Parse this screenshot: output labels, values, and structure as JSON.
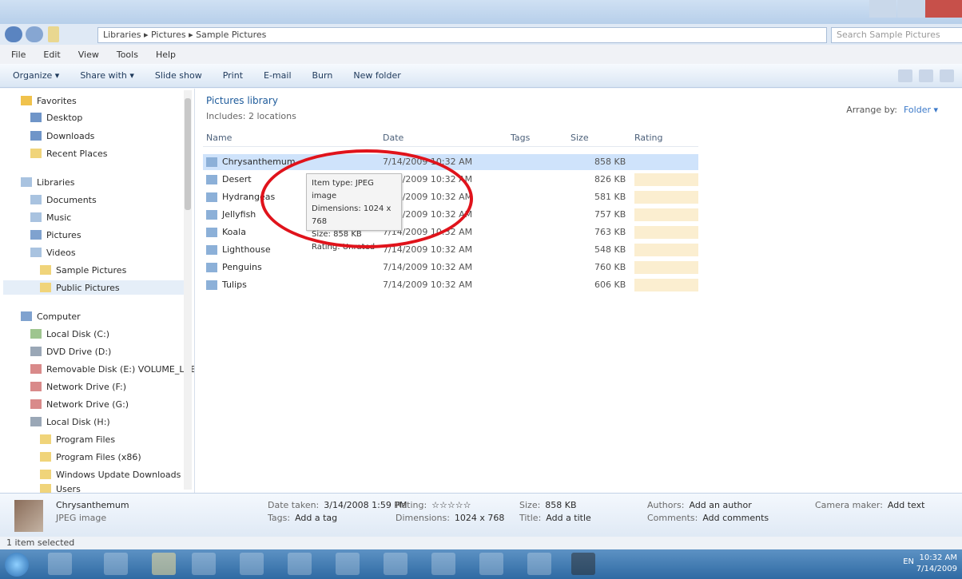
{
  "window": {
    "address": "Libraries ▸ Pictures ▸ Sample Pictures",
    "search_placeholder": "Search Sample Pictures"
  },
  "menu": [
    "File",
    "Edit",
    "View",
    "Tools",
    "Help"
  ],
  "toolbar": [
    "Organize ▾",
    "Share with ▾",
    "Slide show",
    "Print",
    "E-mail",
    "Burn",
    "New folder"
  ],
  "nav": {
    "favorites": [
      "Favorites",
      "Desktop",
      "Downloads",
      "Recent Places"
    ],
    "libraries": [
      "Libraries",
      "Documents",
      "Music",
      "Pictures",
      "Videos",
      "Sample Pictures",
      "Public Pictures"
    ],
    "computer": [
      "Computer",
      "Local Disk (C:)",
      "DVD Drive (D:)",
      "Removable Disk (E:) VOLUME_LABEL",
      "Network Drive (F:)",
      "Network Drive (G:)",
      "Local Disk (H:)",
      "Program Files",
      "Program Files (x86)",
      "Windows Update Downloads",
      "Users"
    ]
  },
  "content": {
    "library_title": "Pictures library",
    "library_subtitle": "Includes: 2 locations",
    "arrange_label": "Arrange by:",
    "arrange_value": "Folder ▾",
    "columns": [
      "Name",
      "Date",
      "Tags",
      "Size",
      "Rating"
    ],
    "rows": [
      {
        "name": "Chrysanthemum",
        "date": "7/14/2009 10:32 AM",
        "type": "",
        "size": "858 KB"
      },
      {
        "name": "Desert",
        "date": "7/14/2009 10:32 AM",
        "type": "",
        "size": "826 KB"
      },
      {
        "name": "Hydrangeas",
        "date": "7/14/2009 10:32 AM",
        "type": "",
        "size": "581 KB"
      },
      {
        "name": "Jellyfish",
        "date": "7/14/2009 10:32 AM",
        "type": "",
        "size": "757 KB"
      },
      {
        "name": "Koala",
        "date": "7/14/2009 10:32 AM",
        "type": "",
        "size": "763 KB"
      },
      {
        "name": "Lighthouse",
        "date": "7/14/2009 10:32 AM",
        "type": "",
        "size": "548 KB"
      },
      {
        "name": "Penguins",
        "date": "7/14/2009 10:32 AM",
        "type": "",
        "size": "760 KB"
      },
      {
        "name": "Tulips",
        "date": "7/14/2009 10:32 AM",
        "type": "",
        "size": "606 KB"
      }
    ],
    "tooltip": [
      "Item type: JPEG image",
      "Dimensions: 1024 x 768",
      "Size: 858 KB",
      "Rating: Unrated"
    ]
  },
  "details": {
    "filename": "Chrysanthemum",
    "filetype": "JPEG image",
    "fields": [
      {
        "k": "Date taken:",
        "v": "3/14/2008 1:59 PM"
      },
      {
        "k": "Tags:",
        "v": "Add a tag"
      },
      {
        "k": "Rating:",
        "v": "☆☆☆☆☆"
      },
      {
        "k": "Dimensions:",
        "v": "1024 x 768"
      },
      {
        "k": "Size:",
        "v": "858 KB"
      },
      {
        "k": "Title:",
        "v": "Add a title"
      },
      {
        "k": "Authors:",
        "v": "Add an author"
      },
      {
        "k": "Comments:",
        "v": "Add comments"
      },
      {
        "k": "Camera maker:",
        "v": "Add text"
      }
    ]
  },
  "status": "1 item selected",
  "taskbar": {
    "tray": "EN",
    "time": "10:32 AM",
    "date": "7/14/2009"
  }
}
